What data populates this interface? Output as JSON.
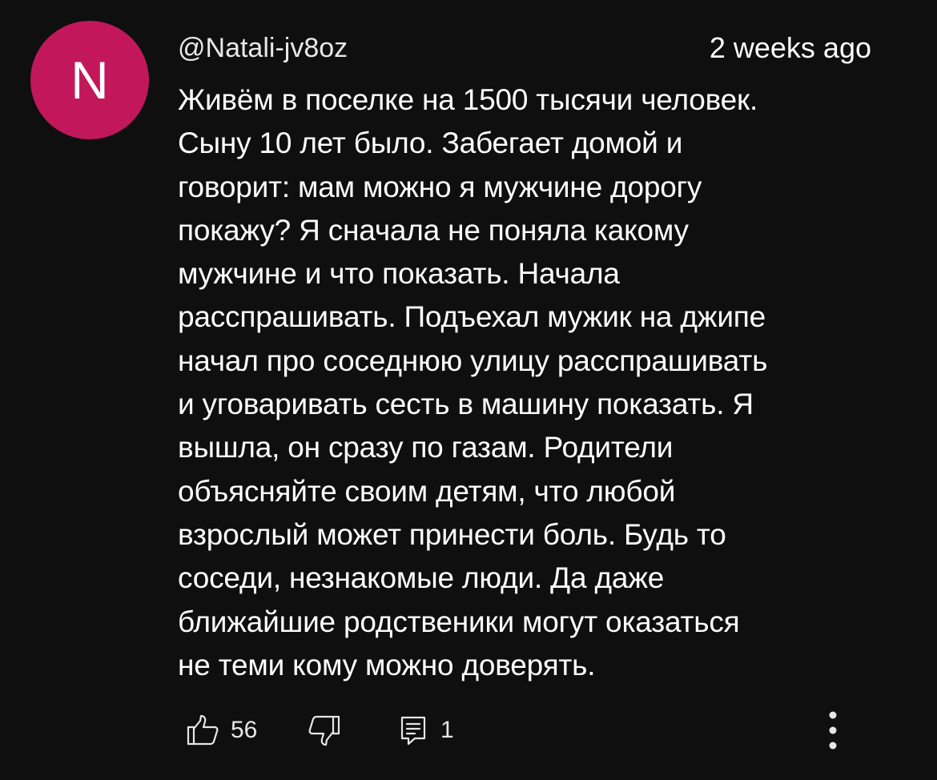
{
  "author": {
    "handle": "@Natali-jv8oz",
    "avatar_letter": "N",
    "avatar_color": "#c2185b"
  },
  "timestamp": "2 weeks ago",
  "comment_text": "Живём в поселке на 1500 тысячи человек.\nСыну 10 лет было. Забегает домой и\nговорит: мам можно я мужчине дорогу\nпокажу? Я сначала не поняла какому\nмужчине и что показать. Начала\nрасспрашивать. Подъехал мужик на джипе\nначал про соседнюю улицу расспрашивать\nи уговаривать сесть в машину показать.  Я\nвышла, он сразу по газам. Родители\nобъясняйте своим детям, что любой\nвзрослый может принести боль. Будь то\nсоседи, незнакомые люди. Да даже\nближайшие родственики могут оказаться\nне теми кому можно доверять.",
  "actions": {
    "like_count": "56",
    "reply_count": "1",
    "icons": [
      "thumbs-up-icon",
      "thumbs-down-icon",
      "reply-icon",
      "more-vert-icon"
    ]
  }
}
